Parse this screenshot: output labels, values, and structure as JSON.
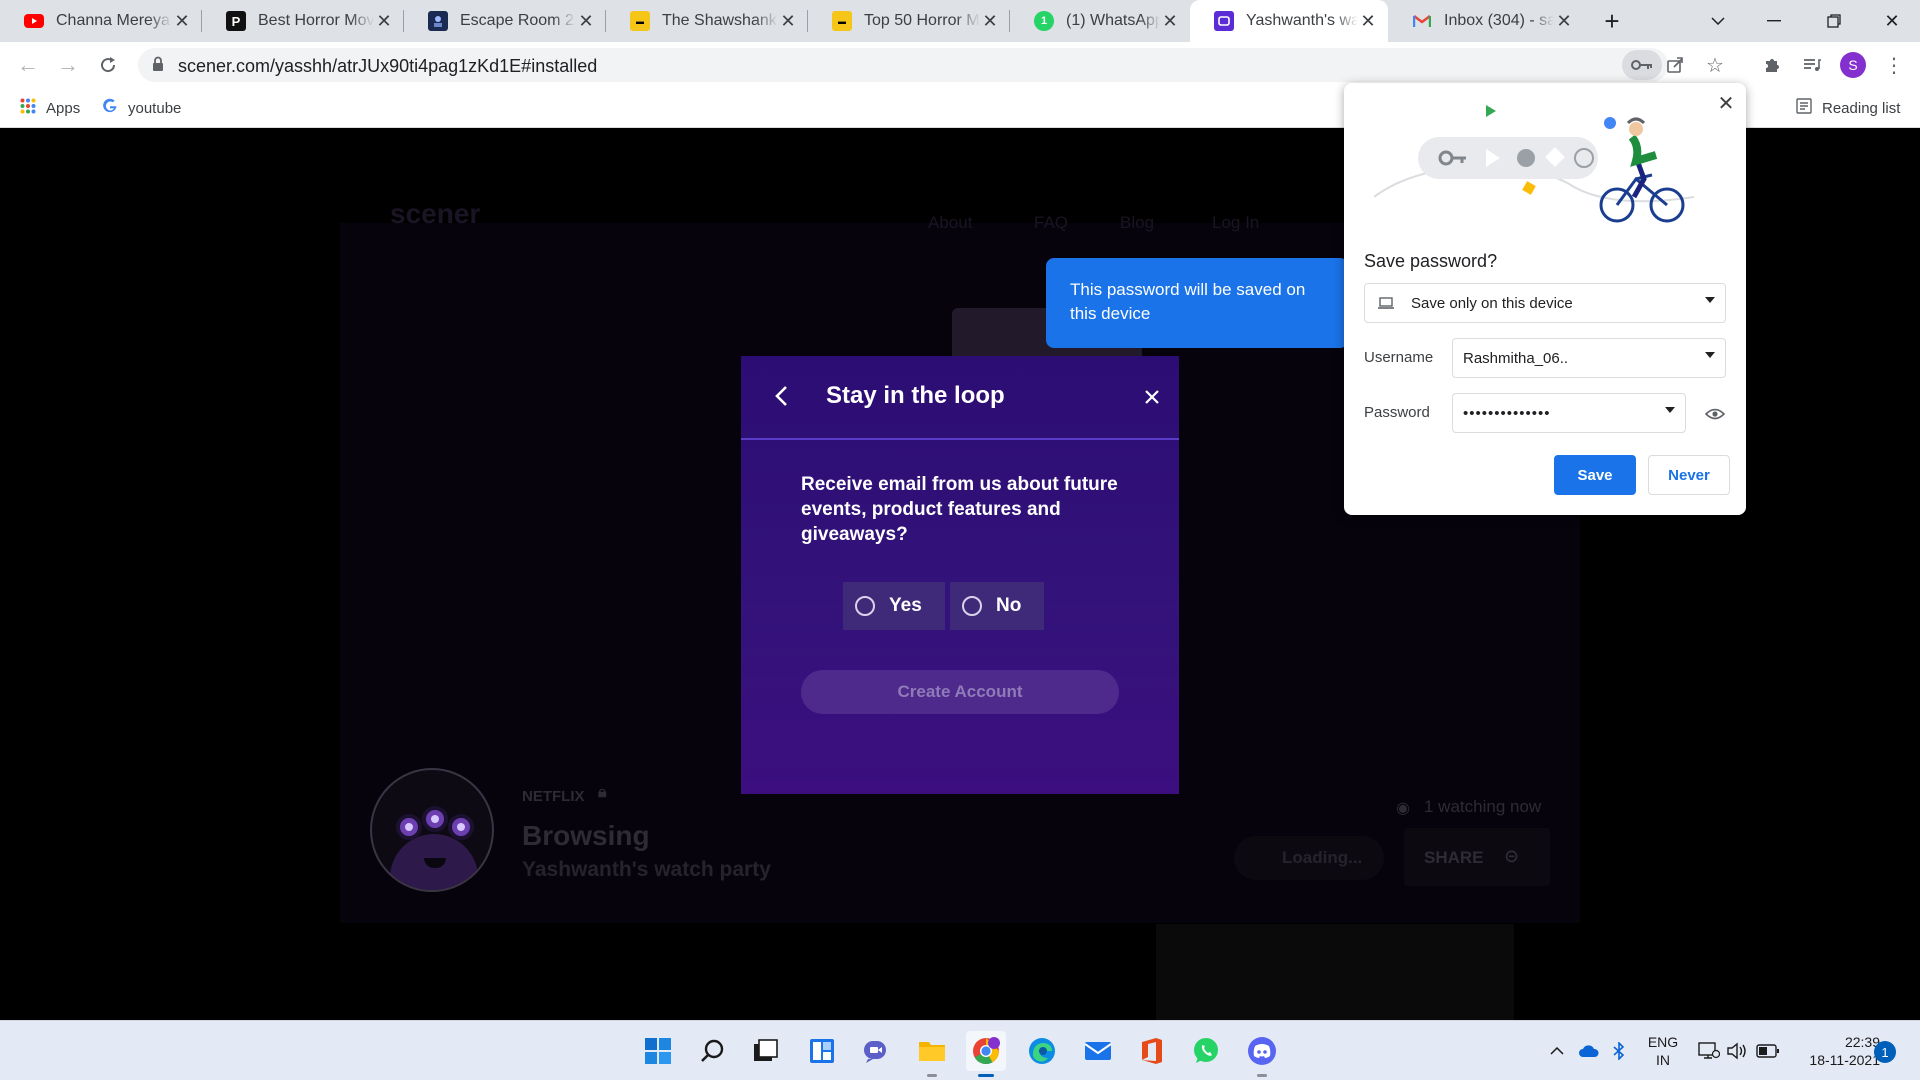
{
  "tabs": [
    {
      "title": "Channa Mereya F",
      "favicon": "youtube-icon",
      "color": "#ff0000"
    },
    {
      "title": "Best Horror Movi",
      "favicon": "p-logo-icon",
      "color": "#000000"
    },
    {
      "title": "Escape Room 2: T",
      "favicon": "poster-icon",
      "color": "#1b2a52"
    },
    {
      "title": "The Shawshank R",
      "favicon": "imdb-icon",
      "color": "#f5c518"
    },
    {
      "title": "Top 50 Horror Mo",
      "favicon": "imdb-icon",
      "color": "#f5c518"
    },
    {
      "title": "(1) WhatsApp",
      "favicon": "whatsapp-icon",
      "color": "#25d366",
      "badge": "1"
    },
    {
      "title": "Yashwanth's watc",
      "favicon": "scener-icon",
      "color": "#5b2bd6",
      "active": true
    },
    {
      "title": "Inbox (304) - sad",
      "favicon": "gmail-icon",
      "color": "#ea4335"
    }
  ],
  "address_bar": {
    "url": "scener.com/yasshh/atrJUx90ti4pag1zKd1E#installed"
  },
  "profile_initial": "S",
  "bookmarks": {
    "apps_label": "Apps",
    "youtube_label": "youtube",
    "reading_list_label": "Reading list"
  },
  "site": {
    "logo_text": "scener",
    "nav": [
      "About",
      "FAQ",
      "Blog",
      "Log In"
    ],
    "service": "NETFLIX",
    "status": "Browsing",
    "party_name": "Yashwanth's watch party",
    "watching": "1 watching now",
    "loading": "Loading...",
    "share": "SHARE"
  },
  "modal": {
    "title": "Stay in the loop",
    "question": "Receive email from us about future events, product features and giveaways?",
    "options": [
      "Yes",
      "No"
    ],
    "create_account": "Create Account"
  },
  "password_bubble": {
    "title": "Save password?",
    "storage_option": "Save only on this device",
    "username_label": "Username",
    "username_value": "Rashmitha_06..",
    "password_label": "Password",
    "password_value": "••••••••••••••",
    "save_label": "Save",
    "never_label": "Never",
    "tooltip": "This password will be saved on this device"
  },
  "taskbar": {
    "lang_line1": "ENG",
    "lang_line2": "IN",
    "time": "22:39",
    "date": "18-11-2021",
    "notifications": "1"
  }
}
